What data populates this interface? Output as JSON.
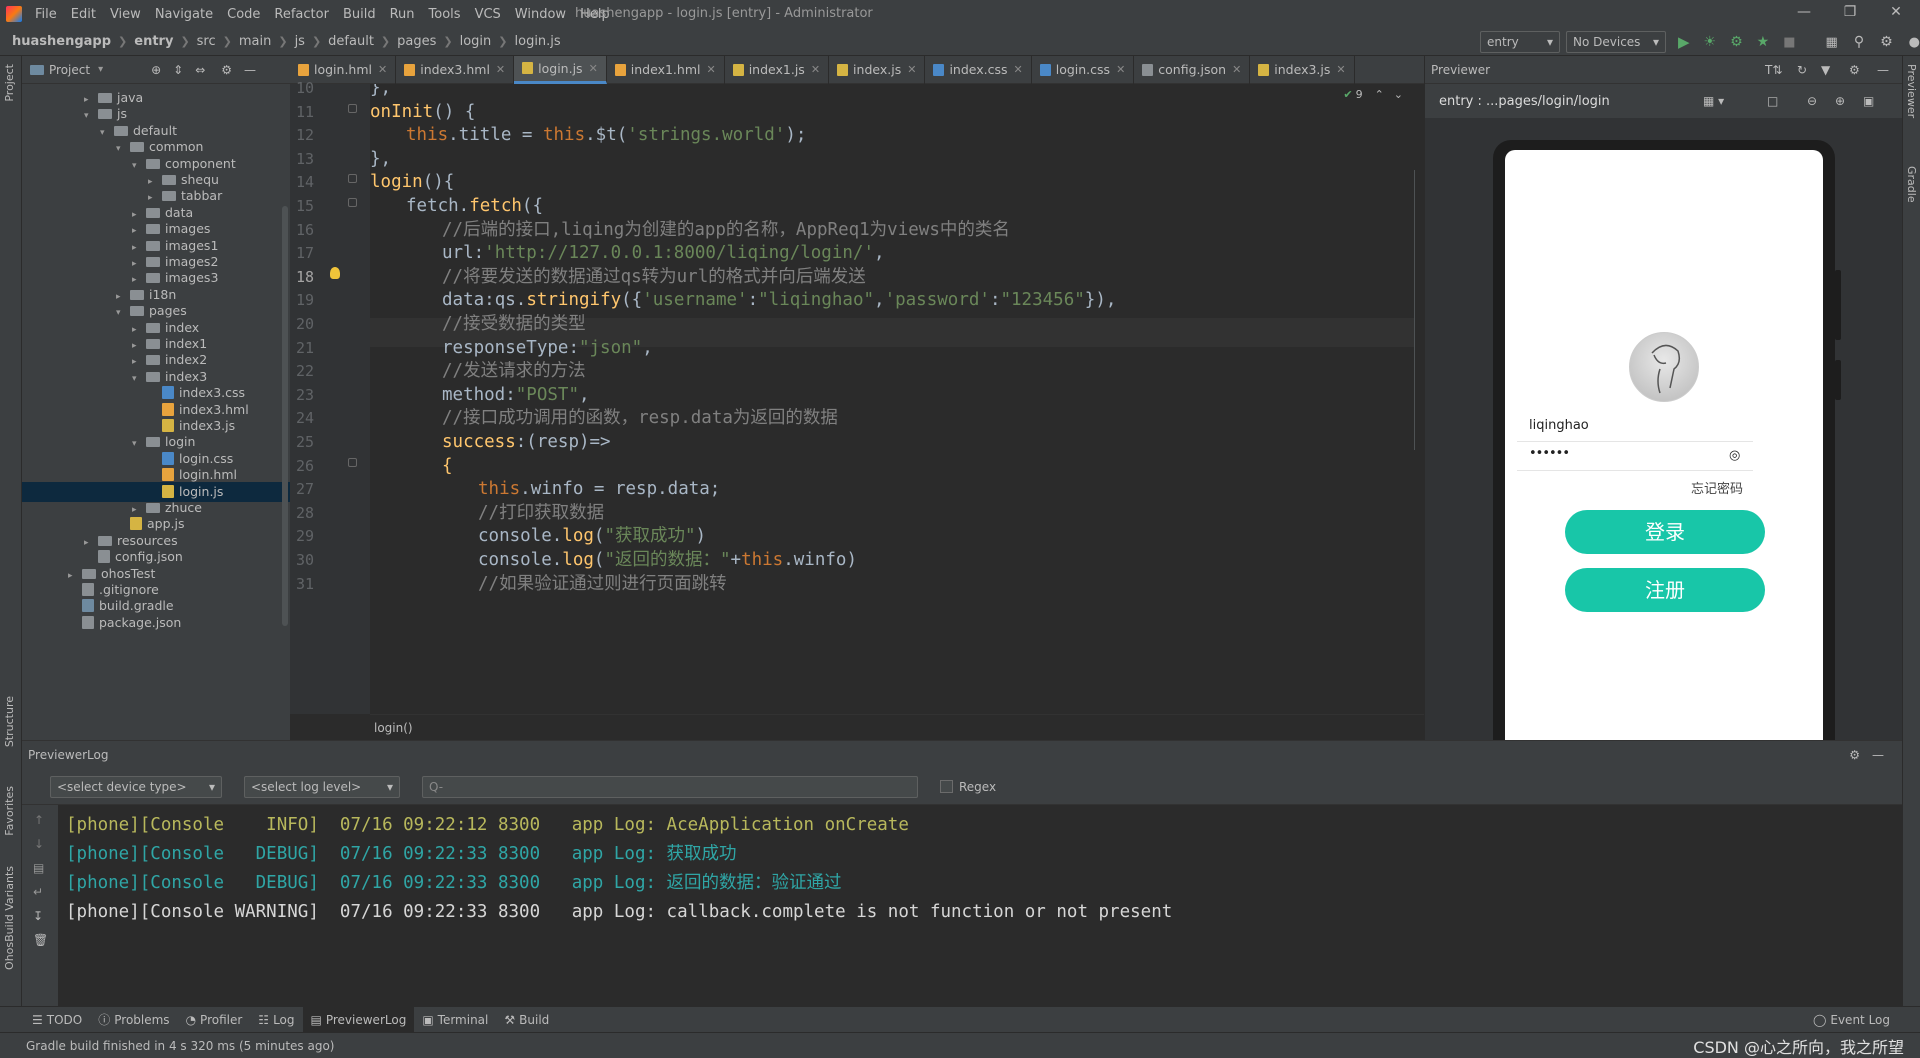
{
  "menubar": {
    "items": [
      "File",
      "Edit",
      "View",
      "Navigate",
      "Code",
      "Refactor",
      "Build",
      "Run",
      "Tools",
      "VCS",
      "Window",
      "Help"
    ],
    "window_title": "huashengapp - login.js [entry] - Administrator"
  },
  "breadcrumb": [
    "huashengapp",
    "entry",
    "src",
    "main",
    "js",
    "default",
    "pages",
    "login",
    "login.js"
  ],
  "run_config": {
    "module": "entry",
    "device": "No Devices"
  },
  "project": {
    "header": "Project",
    "tree": [
      {
        "label": "java",
        "depth": 4,
        "kind": "folder",
        "open": false
      },
      {
        "label": "js",
        "depth": 4,
        "kind": "folder",
        "open": true
      },
      {
        "label": "default",
        "depth": 5,
        "kind": "folder",
        "open": true
      },
      {
        "label": "common",
        "depth": 6,
        "kind": "folder",
        "open": true
      },
      {
        "label": "component",
        "depth": 7,
        "kind": "folder",
        "open": true
      },
      {
        "label": "shequ",
        "depth": 8,
        "kind": "folder",
        "open": false
      },
      {
        "label": "tabbar",
        "depth": 8,
        "kind": "folder",
        "open": false
      },
      {
        "label": "data",
        "depth": 7,
        "kind": "folder",
        "open": false
      },
      {
        "label": "images",
        "depth": 7,
        "kind": "folder",
        "open": false
      },
      {
        "label": "images1",
        "depth": 7,
        "kind": "folder",
        "open": false
      },
      {
        "label": "images2",
        "depth": 7,
        "kind": "folder",
        "open": false
      },
      {
        "label": "images3",
        "depth": 7,
        "kind": "folder",
        "open": false
      },
      {
        "label": "i18n",
        "depth": 6,
        "kind": "folder",
        "open": false
      },
      {
        "label": "pages",
        "depth": 6,
        "kind": "folder",
        "open": true
      },
      {
        "label": "index",
        "depth": 7,
        "kind": "folder",
        "open": false
      },
      {
        "label": "index1",
        "depth": 7,
        "kind": "folder",
        "open": false
      },
      {
        "label": "index2",
        "depth": 7,
        "kind": "folder",
        "open": false
      },
      {
        "label": "index3",
        "depth": 7,
        "kind": "folder",
        "open": true
      },
      {
        "label": "index3.css",
        "depth": 8,
        "kind": "css"
      },
      {
        "label": "index3.hml",
        "depth": 8,
        "kind": "hml"
      },
      {
        "label": "index3.js",
        "depth": 8,
        "kind": "js"
      },
      {
        "label": "login",
        "depth": 7,
        "kind": "folder",
        "open": true
      },
      {
        "label": "login.css",
        "depth": 8,
        "kind": "css"
      },
      {
        "label": "login.hml",
        "depth": 8,
        "kind": "hml"
      },
      {
        "label": "login.js",
        "depth": 8,
        "kind": "js",
        "selected": true
      },
      {
        "label": "zhuce",
        "depth": 7,
        "kind": "folder",
        "open": false
      },
      {
        "label": "app.js",
        "depth": 6,
        "kind": "js"
      },
      {
        "label": "resources",
        "depth": 4,
        "kind": "folder",
        "open": false
      },
      {
        "label": "config.json",
        "depth": 4,
        "kind": "json"
      },
      {
        "label": "ohosTest",
        "depth": 3,
        "kind": "folder",
        "open": false
      },
      {
        "label": ".gitignore",
        "depth": 3,
        "kind": "file"
      },
      {
        "label": "build.gradle",
        "depth": 3,
        "kind": "gradle"
      },
      {
        "label": "package.json",
        "depth": 3,
        "kind": "json"
      }
    ]
  },
  "tabs": [
    {
      "label": "login.hml",
      "color": "#e8a33d"
    },
    {
      "label": "index3.hml",
      "color": "#e8a33d"
    },
    {
      "label": "login.js",
      "color": "#d5b443",
      "active": true
    },
    {
      "label": "index1.hml",
      "color": "#e8a33d"
    },
    {
      "label": "index1.js",
      "color": "#d5b443"
    },
    {
      "label": "index.js",
      "color": "#d5b443"
    },
    {
      "label": "index.css",
      "color": "#4a88c7"
    },
    {
      "label": "login.css",
      "color": "#4a88c7"
    },
    {
      "label": "config.json",
      "color": "#8a8f93"
    },
    {
      "label": "index3.js",
      "color": "#d5b443"
    }
  ],
  "editor": {
    "inspection_count": "9",
    "current_line": 18,
    "footer_breadcrumb": "login()",
    "lines": [
      {
        "n": "10",
        "indent": 0,
        "parts": [
          {
            "t": "},",
            "c": "plain"
          }
        ]
      },
      {
        "n": "11",
        "indent": 0,
        "parts": [
          {
            "t": "onInit",
            "c": "fn"
          },
          {
            "t": "() {",
            "c": "plain"
          }
        ]
      },
      {
        "n": "12",
        "indent": 1,
        "parts": [
          {
            "t": "this",
            "c": "kw"
          },
          {
            "t": ".title = ",
            "c": "plain"
          },
          {
            "t": "this",
            "c": "kw"
          },
          {
            "t": ".$t(",
            "c": "plain"
          },
          {
            "t": "'strings.world'",
            "c": "str"
          },
          {
            "t": ");",
            "c": "plain"
          }
        ]
      },
      {
        "n": "13",
        "indent": 0,
        "parts": [
          {
            "t": "},",
            "c": "plain"
          }
        ]
      },
      {
        "n": "14",
        "indent": 0,
        "parts": [
          {
            "t": "login",
            "c": "fn"
          },
          {
            "t": "(){",
            "c": "plain"
          }
        ]
      },
      {
        "n": "15",
        "indent": 1,
        "parts": [
          {
            "t": "fetch.",
            "c": "plain"
          },
          {
            "t": "fetch",
            "c": "fn"
          },
          {
            "t": "({",
            "c": "plain"
          }
        ]
      },
      {
        "n": "16",
        "indent": 2,
        "parts": [
          {
            "t": "//后端的接口,liqing为创建的app的名称，AppReq1为views中的类名",
            "c": "cm"
          }
        ]
      },
      {
        "n": "17",
        "indent": 2,
        "parts": [
          {
            "t": "url",
            "c": "plain"
          },
          {
            "t": ":",
            "c": "plain"
          },
          {
            "t": "'http://127.0.0.1:8000/liqing/login/'",
            "c": "str"
          },
          {
            "t": ",",
            "c": "plain"
          }
        ]
      },
      {
        "n": "18",
        "indent": 2,
        "parts": [
          {
            "t": "//将要发送的数据通过qs转为url的格式并向后端发送",
            "c": "cm"
          }
        ]
      },
      {
        "n": "19",
        "indent": 2,
        "parts": [
          {
            "t": "data",
            "c": "plain"
          },
          {
            "t": ":qs.",
            "c": "plain"
          },
          {
            "t": "stringify",
            "c": "fn"
          },
          {
            "t": "({",
            "c": "plain"
          },
          {
            "t": "'username'",
            "c": "str"
          },
          {
            "t": ":",
            "c": "plain"
          },
          {
            "t": "\"liqinghao\"",
            "c": "str"
          },
          {
            "t": ",",
            "c": "plain"
          },
          {
            "t": "'password'",
            "c": "str"
          },
          {
            "t": ":",
            "c": "plain"
          },
          {
            "t": "\"123456\"",
            "c": "str"
          },
          {
            "t": "}),",
            "c": "plain"
          }
        ]
      },
      {
        "n": "20",
        "indent": 2,
        "parts": [
          {
            "t": "//接受数据的类型",
            "c": "cm"
          }
        ]
      },
      {
        "n": "21",
        "indent": 2,
        "parts": [
          {
            "t": "responseType",
            "c": "plain"
          },
          {
            "t": ":",
            "c": "plain"
          },
          {
            "t": "\"json\"",
            "c": "str"
          },
          {
            "t": ",",
            "c": "plain"
          }
        ]
      },
      {
        "n": "22",
        "indent": 2,
        "parts": [
          {
            "t": "//发送请求的方法",
            "c": "cm"
          }
        ]
      },
      {
        "n": "23",
        "indent": 2,
        "parts": [
          {
            "t": "method",
            "c": "plain"
          },
          {
            "t": ":",
            "c": "plain"
          },
          {
            "t": "\"POST\"",
            "c": "str"
          },
          {
            "t": ",",
            "c": "plain"
          }
        ]
      },
      {
        "n": "24",
        "indent": 2,
        "parts": [
          {
            "t": "//接口成功调用的函数，resp.data为返回的数据",
            "c": "cm"
          }
        ]
      },
      {
        "n": "25",
        "indent": 2,
        "parts": [
          {
            "t": "success",
            "c": "fn"
          },
          {
            "t": ":(resp)=>",
            "c": "plain"
          }
        ]
      },
      {
        "n": "26",
        "indent": 2,
        "parts": [
          {
            "t": "{",
            "c": "fn"
          }
        ]
      },
      {
        "n": "27",
        "indent": 3,
        "parts": [
          {
            "t": "this",
            "c": "kw"
          },
          {
            "t": ".winfo = resp.data;",
            "c": "plain"
          }
        ]
      },
      {
        "n": "28",
        "indent": 3,
        "parts": [
          {
            "t": "//打印获取数据",
            "c": "cm"
          }
        ]
      },
      {
        "n": "29",
        "indent": 3,
        "parts": [
          {
            "t": "console.",
            "c": "plain"
          },
          {
            "t": "log",
            "c": "fn"
          },
          {
            "t": "(",
            "c": "plain"
          },
          {
            "t": "\"获取成功\"",
            "c": "str"
          },
          {
            "t": ")",
            "c": "plain"
          }
        ]
      },
      {
        "n": "30",
        "indent": 3,
        "parts": [
          {
            "t": "console.",
            "c": "plain"
          },
          {
            "t": "log",
            "c": "fn"
          },
          {
            "t": "(",
            "c": "plain"
          },
          {
            "t": "\"返回的数据：\"",
            "c": "str"
          },
          {
            "t": "+",
            "c": "plain"
          },
          {
            "t": "this",
            "c": "kw"
          },
          {
            "t": ".winfo)",
            "c": "plain"
          }
        ]
      },
      {
        "n": "31",
        "indent": 3,
        "parts": [
          {
            "t": "//如果验证通过则进行页面跳转",
            "c": "cm"
          }
        ]
      }
    ]
  },
  "previewer": {
    "title": "Previewer",
    "path": "entry : ...pages/login/login",
    "username": "liqinghao",
    "password_mask": "••••••",
    "forgot": "忘记密码",
    "login_button": "登录",
    "register_button": "注册"
  },
  "log": {
    "title": "PreviewerLog",
    "device_select": "<select device type>",
    "level_select": "<select log level>",
    "search_placeholder": "Q-",
    "regex_label": "Regex",
    "lines": [
      {
        "text": "[phone][Console    INFO]  07/16 09:22:12 8300   app Log: AceApplication onCreate",
        "color": "#b8b85c"
      },
      {
        "text": "[phone][Console   DEBUG]  07/16 09:22:33 8300   app Log: 获取成功",
        "color": "#2fa6a6"
      },
      {
        "text": "[phone][Console   DEBUG]  07/16 09:22:33 8300   app Log: 返回的数据：验证通过",
        "color": "#2fa6a6"
      },
      {
        "text": "[phone][Console WARNING]  07/16 09:22:33 8300   app Log: callback.complete is not function or not present",
        "color": "#d6d6d6"
      }
    ]
  },
  "bottom_tools": [
    "TODO",
    "Problems",
    "Profiler",
    "Log",
    "PreviewerLog",
    "Terminal",
    "Build"
  ],
  "event_log": "Event Log",
  "status": "Gradle build finished in 4 s 320 ms (5 minutes ago)",
  "watermark": "CSDN @心之所向，我之所望",
  "side_labels": {
    "project": "Project",
    "structure": "Structure",
    "favorites": "Favorites",
    "ohos_variants": "OhosBuild Variants",
    "previewer": "Previewer",
    "gradle": "Gradle"
  }
}
